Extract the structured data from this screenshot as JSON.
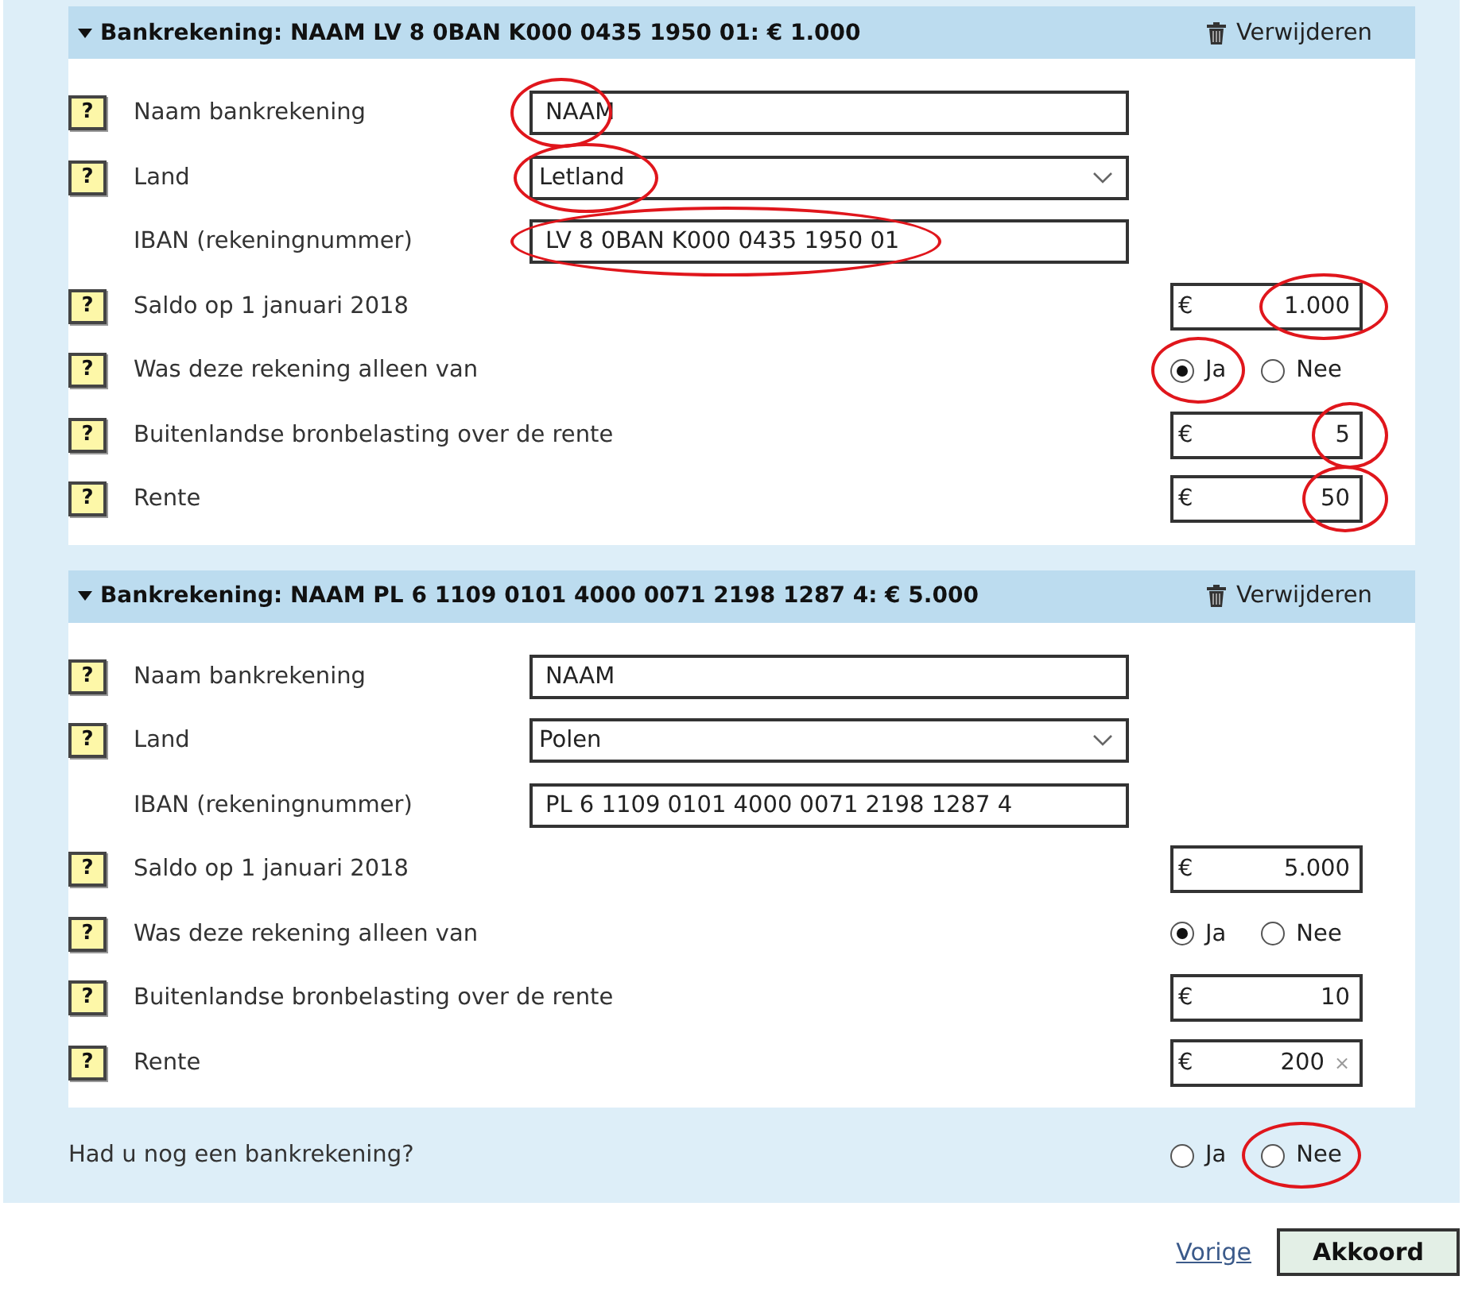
{
  "sections": [
    {
      "title": "Bankrekening: NAAM LV 8 0BAN K000 0435 1950 01: € 1.000",
      "expanded": true,
      "delete_label": "Verwijderen",
      "fields": [
        {
          "kind": "text",
          "help": "?",
          "label": "Naam bankrekening",
          "value": "NAAM",
          "circled": true
        },
        {
          "kind": "select",
          "help": "?",
          "label": "Land",
          "value": "Letland",
          "circled": true
        },
        {
          "kind": "text",
          "label": "IBAN (rekeningnummer)",
          "value": "LV 8 0BAN K000 0435 1950 01",
          "circled": true
        },
        {
          "kind": "amount",
          "help": "?",
          "label": "Saldo op 1 januari 2018",
          "currency": "€",
          "value": "1.000",
          "circled": true
        },
        {
          "kind": "radio",
          "help": "?",
          "label": "Was deze rekening alleen van",
          "options": [
            {
              "label": "Ja",
              "selected": true,
              "circled": true
            },
            {
              "label": "Nee",
              "selected": false,
              "circled": false
            }
          ]
        },
        {
          "kind": "amount",
          "help": "?",
          "label": "Buitenlandse bronbelasting over de rente",
          "currency": "€",
          "value": "5",
          "circled": true
        },
        {
          "kind": "amount",
          "help": "?",
          "label": "Rente",
          "currency": "€",
          "value": "50",
          "circled": true
        }
      ]
    },
    {
      "title": "Bankrekening: NAAM PL 6 1109 0101 4000 0071 2198 1287 4: € 5.000",
      "expanded": true,
      "delete_label": "Verwijderen",
      "fields": [
        {
          "kind": "text",
          "help": "?",
          "label": "Naam bankrekening",
          "value": "NAAM",
          "circled": false
        },
        {
          "kind": "select",
          "help": "?",
          "label": "Land",
          "value": "Polen",
          "circled": false
        },
        {
          "kind": "text",
          "label": "IBAN (rekeningnummer)",
          "value": "PL 6 1109 0101 4000 0071 2198 1287 4",
          "circled": false
        },
        {
          "kind": "amount",
          "help": "?",
          "label": "Saldo op 1 januari 2018",
          "currency": "€",
          "value": "5.000",
          "circled": false
        },
        {
          "kind": "radio",
          "help": "?",
          "label": "Was deze rekening alleen van",
          "options": [
            {
              "label": "Ja",
              "selected": true,
              "circled": false
            },
            {
              "label": "Nee",
              "selected": false,
              "circled": false
            }
          ]
        },
        {
          "kind": "amount",
          "help": "?",
          "label": "Buitenlandse bronbelasting over de rente",
          "currency": "€",
          "value": "10",
          "circled": false
        },
        {
          "kind": "amount",
          "help": "?",
          "label": "Rente",
          "currency": "€",
          "value": "200",
          "clear": "×",
          "circled": false
        }
      ]
    }
  ],
  "question": {
    "label": "Had u nog een bankrekening?",
    "options": [
      {
        "label": "Ja",
        "selected": false,
        "circled": false
      },
      {
        "label": "Nee",
        "selected": false,
        "circled": true
      }
    ]
  },
  "footer": {
    "back_link": "Vorige",
    "submit_button": "Akkoord"
  }
}
